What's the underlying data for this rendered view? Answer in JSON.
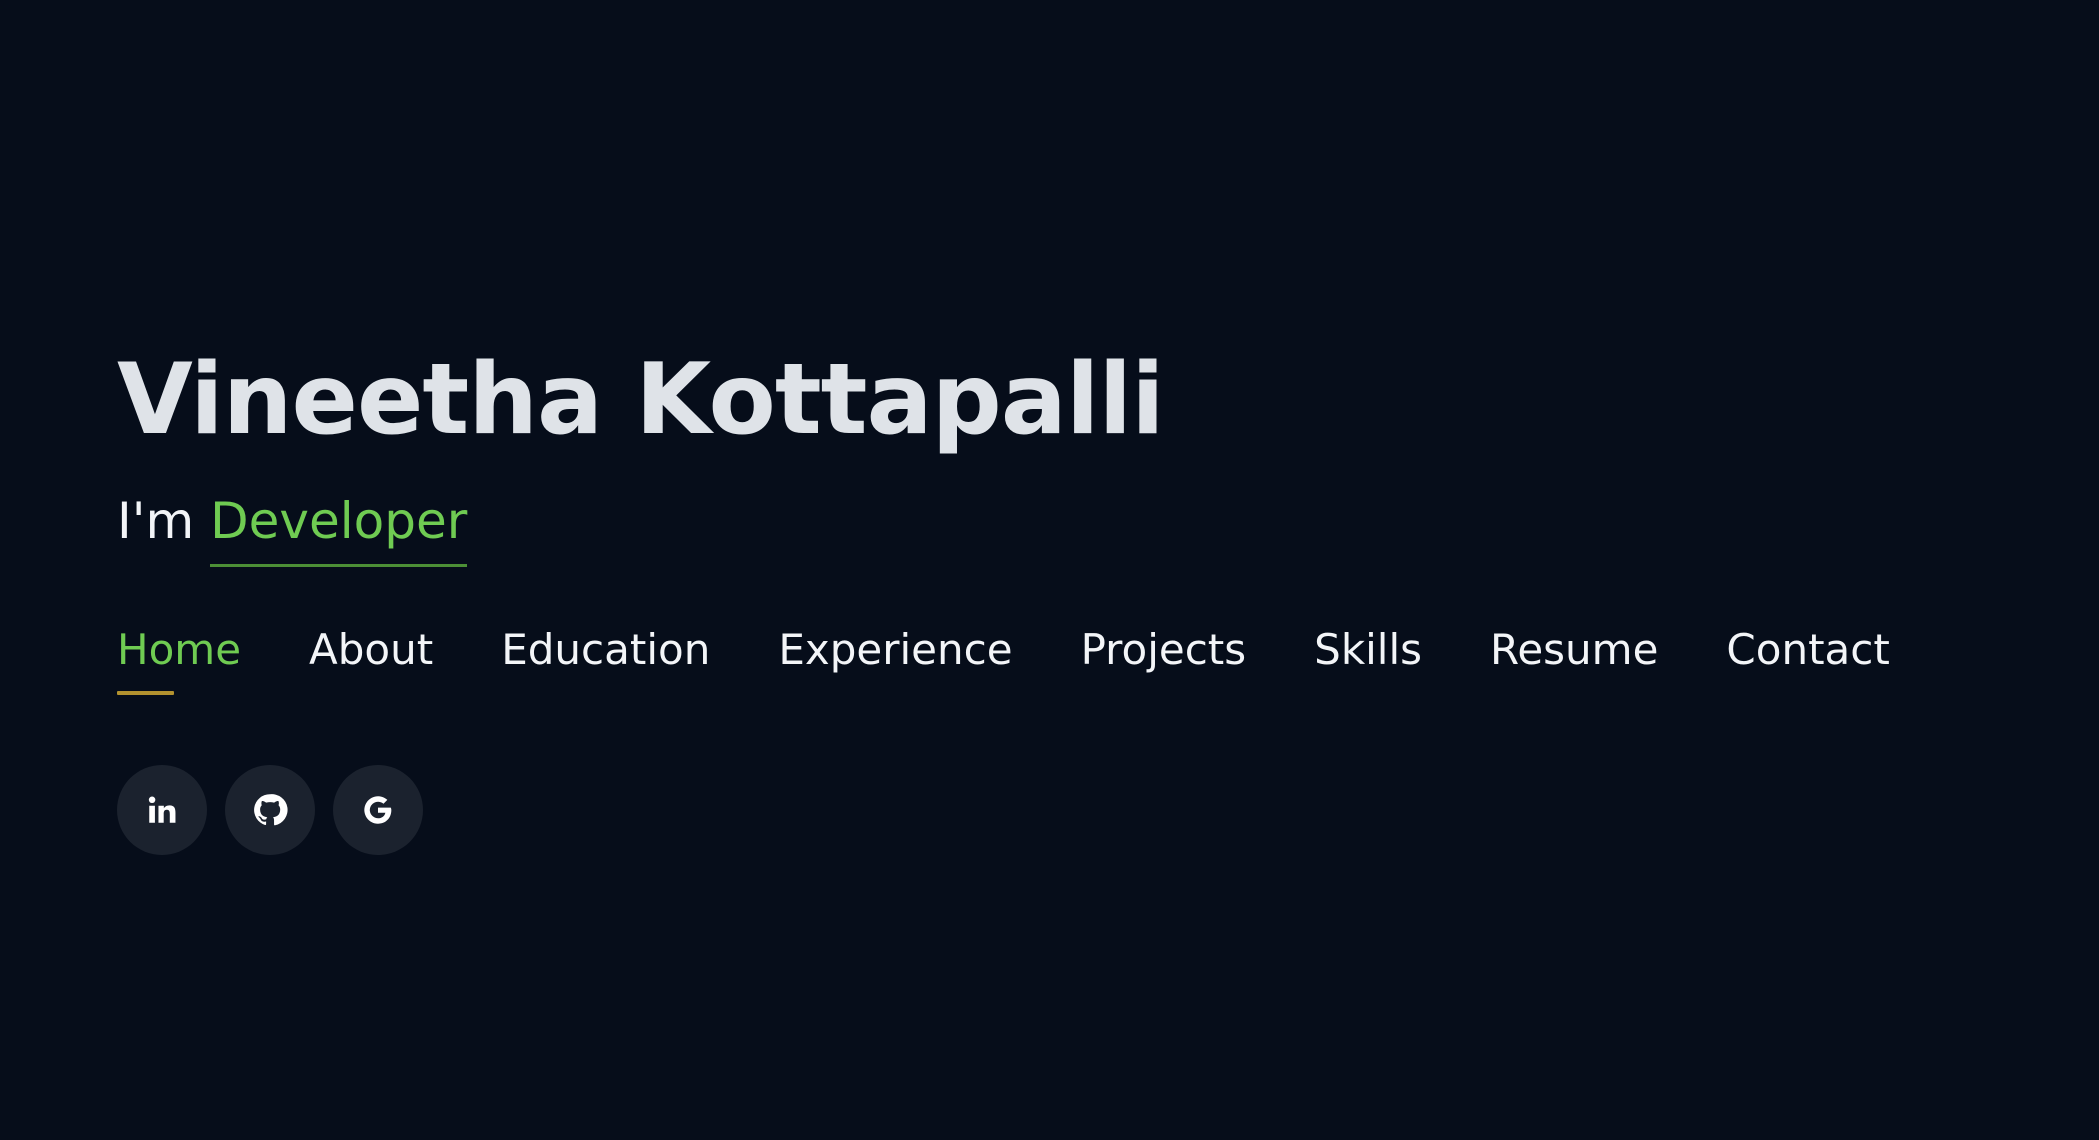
{
  "hero": {
    "name": "Vineetha Kottapalli",
    "tagline_prefix": "I'm",
    "role": "Developer"
  },
  "nav": {
    "items": [
      {
        "label": "Home",
        "active": true
      },
      {
        "label": "About"
      },
      {
        "label": "Education"
      },
      {
        "label": "Experience"
      },
      {
        "label": "Projects"
      },
      {
        "label": "Skills"
      },
      {
        "label": "Resume"
      },
      {
        "label": "Contact"
      }
    ]
  },
  "social": {
    "links": [
      {
        "icon": "linkedin-icon"
      },
      {
        "icon": "github-icon"
      },
      {
        "icon": "google-icon"
      }
    ]
  },
  "colors": {
    "background": "#060d1a",
    "accent_green": "#6fcb52",
    "active_underline": "#b3922f",
    "social_bg": "#1b222e"
  }
}
